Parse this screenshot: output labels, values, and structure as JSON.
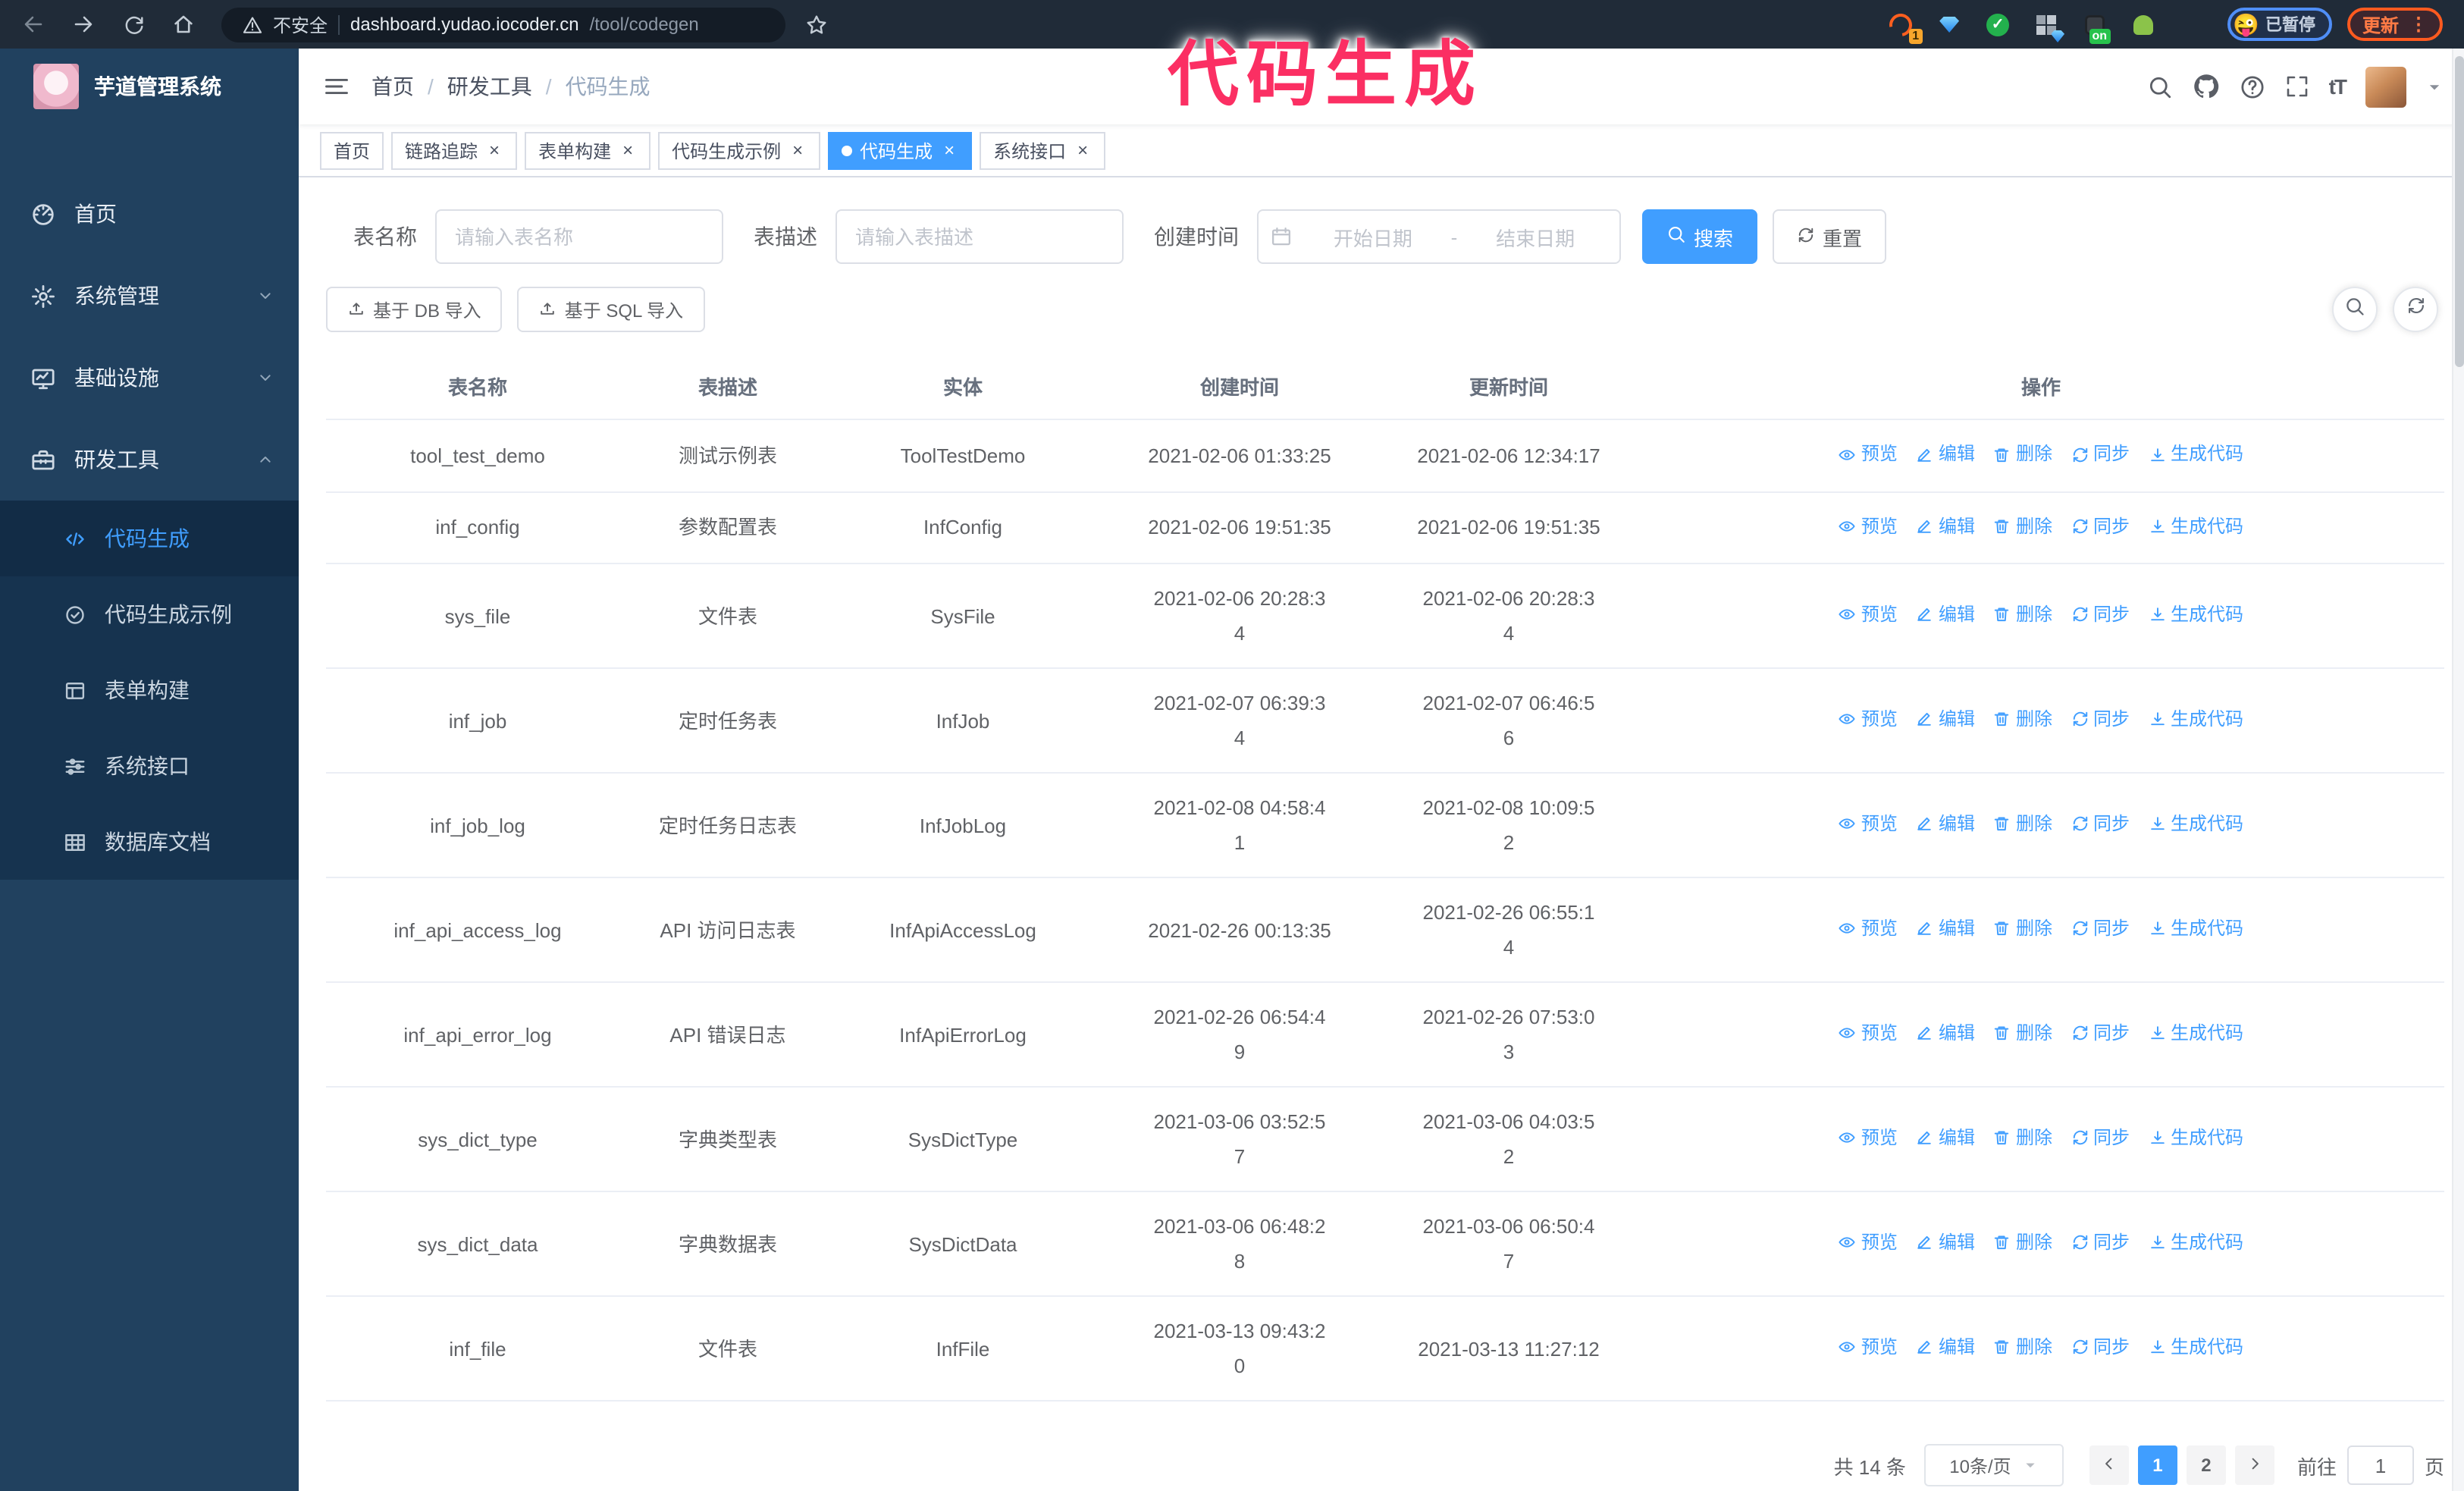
{
  "overlay": {
    "title": "代码生成",
    "color": "#fb2f63"
  },
  "browser": {
    "security_label": "不安全",
    "url_host": "dashboard.yudao.iocoder.cn",
    "url_path": "/tool/codegen",
    "paused_label": "已暂停",
    "update_label": "更新",
    "extensions": [
      {
        "id": "refresh-orange",
        "badge": "1"
      },
      {
        "id": "gem"
      },
      {
        "id": "check-green"
      },
      {
        "id": "grid-gem"
      },
      {
        "id": "dark-on",
        "badge": "on"
      },
      {
        "id": "green-bot"
      },
      {
        "id": "puzzle"
      }
    ]
  },
  "sidebar": {
    "app_title": "芋道管理系统",
    "items": [
      {
        "id": "home",
        "label": "首页",
        "icon": "dashboard",
        "type": "top"
      },
      {
        "id": "system-management",
        "label": "系统管理",
        "icon": "gear",
        "type": "top",
        "chevron": "down"
      },
      {
        "id": "infrastructure",
        "label": "基础设施",
        "icon": "monitor",
        "type": "top",
        "chevron": "down"
      },
      {
        "id": "dev-tools",
        "label": "研发工具",
        "icon": "toolbox",
        "type": "top",
        "chevron": "up"
      },
      {
        "id": "codegen",
        "label": "代码生成",
        "icon": "code",
        "type": "sub",
        "active": true
      },
      {
        "id": "codegen-example",
        "label": "代码生成示例",
        "icon": "badge-check",
        "type": "sub"
      },
      {
        "id": "form-builder",
        "label": "表单构建",
        "icon": "form",
        "type": "sub"
      },
      {
        "id": "system-api",
        "label": "系统接口",
        "icon": "sliders",
        "type": "sub"
      },
      {
        "id": "db-doc",
        "label": "数据库文档",
        "icon": "table-grid",
        "type": "sub"
      }
    ]
  },
  "header": {
    "breadcrumb": [
      "首页",
      "研发工具",
      "代码生成"
    ]
  },
  "tabs": [
    {
      "label": "首页",
      "closable": false,
      "active": false
    },
    {
      "label": "链路追踪",
      "closable": true,
      "active": false
    },
    {
      "label": "表单构建",
      "closable": true,
      "active": false
    },
    {
      "label": "代码生成示例",
      "closable": true,
      "active": false
    },
    {
      "label": "代码生成",
      "closable": true,
      "active": true
    },
    {
      "label": "系统接口",
      "closable": true,
      "active": false
    }
  ],
  "filters": {
    "table_name_label": "表名称",
    "table_name_placeholder": "请输入表名称",
    "table_desc_label": "表描述",
    "table_desc_placeholder": "请输入表描述",
    "create_time_label": "创建时间",
    "start_placeholder": "开始日期",
    "range_separator": "-",
    "end_placeholder": "结束日期",
    "search_label": "搜索",
    "reset_label": "重置"
  },
  "toolbar": {
    "import_db_label": "基于 DB 导入",
    "import_sql_label": "基于 SQL 导入"
  },
  "table": {
    "columns": [
      "表名称",
      "表描述",
      "实体",
      "创建时间",
      "更新时间",
      "操作"
    ],
    "action_labels": [
      "预览",
      "编辑",
      "删除",
      "同步",
      "生成代码"
    ],
    "rows": [
      {
        "name": "tool_test_demo",
        "desc": "测试示例表",
        "entity": "ToolTestDemo",
        "created": [
          "2021-02-06 01:33:25"
        ],
        "updated": [
          "2021-02-06 12:34:17"
        ]
      },
      {
        "name": "inf_config",
        "desc": "参数配置表",
        "entity": "InfConfig",
        "created": [
          "2021-02-06 19:51:35"
        ],
        "updated": [
          "2021-02-06 19:51:35"
        ]
      },
      {
        "name": "sys_file",
        "desc": "文件表",
        "entity": "SysFile",
        "created": [
          "2021-02-06 20:28:3",
          "4"
        ],
        "updated": [
          "2021-02-06 20:28:3",
          "4"
        ]
      },
      {
        "name": "inf_job",
        "desc": "定时任务表",
        "entity": "InfJob",
        "created": [
          "2021-02-07 06:39:3",
          "4"
        ],
        "updated": [
          "2021-02-07 06:46:5",
          "6"
        ]
      },
      {
        "name": "inf_job_log",
        "desc": "定时任务日志表",
        "entity": "InfJobLog",
        "created": [
          "2021-02-08 04:58:4",
          "1"
        ],
        "updated": [
          "2021-02-08 10:09:5",
          "2"
        ]
      },
      {
        "name": "inf_api_access_log",
        "desc": "API 访问日志表",
        "entity": "InfApiAccessLog",
        "created": [
          "2021-02-26 00:13:35"
        ],
        "updated": [
          "2021-02-26 06:55:1",
          "4"
        ]
      },
      {
        "name": "inf_api_error_log",
        "desc": "API 错误日志",
        "entity": "InfApiErrorLog",
        "created": [
          "2021-02-26 06:54:4",
          "9"
        ],
        "updated": [
          "2021-02-26 07:53:0",
          "3"
        ]
      },
      {
        "name": "sys_dict_type",
        "desc": "字典类型表",
        "entity": "SysDictType",
        "created": [
          "2021-03-06 03:52:5",
          "7"
        ],
        "updated": [
          "2021-03-06 04:03:5",
          "2"
        ]
      },
      {
        "name": "sys_dict_data",
        "desc": "字典数据表",
        "entity": "SysDictData",
        "created": [
          "2021-03-06 06:48:2",
          "8"
        ],
        "updated": [
          "2021-03-06 06:50:4",
          "7"
        ]
      },
      {
        "name": "inf_file",
        "desc": "文件表",
        "entity": "InfFile",
        "created": [
          "2021-03-13 09:43:2",
          "0"
        ],
        "updated": [
          "2021-03-13 11:27:12"
        ]
      }
    ]
  },
  "pagination": {
    "total_label": "共 14 条",
    "page_size_label": "10条/页",
    "pages": [
      "1",
      "2"
    ],
    "active_page": "1",
    "goto_label": "前往",
    "goto_value": "1",
    "page_unit_label": "页"
  }
}
